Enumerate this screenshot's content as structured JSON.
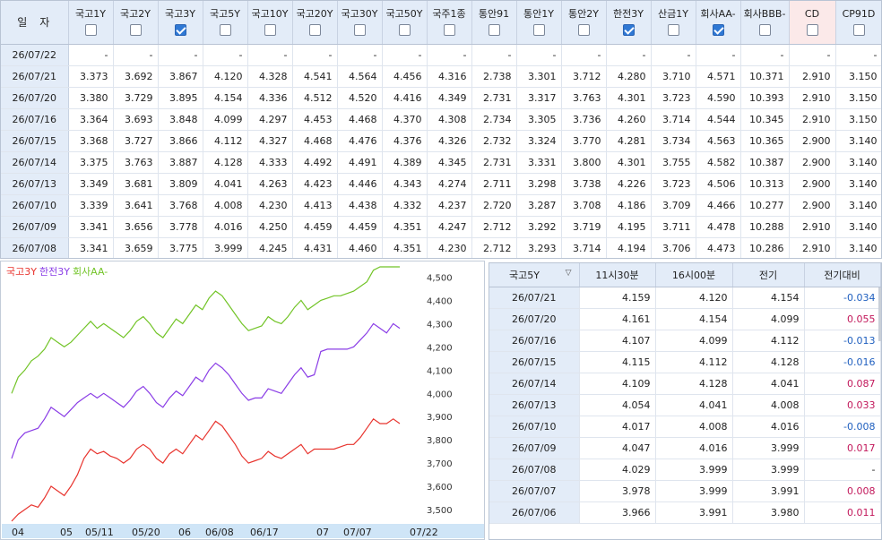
{
  "top_grid": {
    "date_header": "일자",
    "columns": [
      {
        "label": "국고1Y",
        "checked": false
      },
      {
        "label": "국고2Y",
        "checked": false
      },
      {
        "label": "국고3Y",
        "checked": true
      },
      {
        "label": "국고5Y",
        "checked": false
      },
      {
        "label": "국고10Y",
        "checked": false
      },
      {
        "label": "국고20Y",
        "checked": false
      },
      {
        "label": "국고30Y",
        "checked": false
      },
      {
        "label": "국고50Y",
        "checked": false
      },
      {
        "label": "국주1종",
        "checked": false
      },
      {
        "label": "통안91",
        "checked": false
      },
      {
        "label": "통안1Y",
        "checked": false
      },
      {
        "label": "통안2Y",
        "checked": false
      },
      {
        "label": "한전3Y",
        "checked": true
      },
      {
        "label": "산금1Y",
        "checked": false
      },
      {
        "label": "회사AA-",
        "checked": true
      },
      {
        "label": "회사BBB-",
        "checked": false
      },
      {
        "label": "CD",
        "checked": false,
        "pink": true
      },
      {
        "label": "CP91D",
        "checked": false
      }
    ],
    "rows": [
      {
        "date": "26/07/22",
        "values": [
          "-",
          "-",
          "-",
          "-",
          "-",
          "-",
          "-",
          "-",
          "-",
          "-",
          "-",
          "-",
          "-",
          "-",
          "-",
          "-",
          "-",
          "-"
        ]
      },
      {
        "date": "26/07/21",
        "values": [
          "3.373",
          "3.692",
          "3.867",
          "4.120",
          "4.328",
          "4.541",
          "4.564",
          "4.456",
          "4.316",
          "2.738",
          "3.301",
          "3.712",
          "4.280",
          "3.710",
          "4.571",
          "10.371",
          "2.910",
          "3.150"
        ]
      },
      {
        "date": "26/07/20",
        "values": [
          "3.380",
          "3.729",
          "3.895",
          "4.154",
          "4.336",
          "4.512",
          "4.520",
          "4.416",
          "4.349",
          "2.731",
          "3.317",
          "3.763",
          "4.301",
          "3.723",
          "4.590",
          "10.393",
          "2.910",
          "3.150"
        ]
      },
      {
        "date": "26/07/16",
        "values": [
          "3.364",
          "3.693",
          "3.848",
          "4.099",
          "4.297",
          "4.453",
          "4.468",
          "4.370",
          "4.308",
          "2.734",
          "3.305",
          "3.736",
          "4.260",
          "3.714",
          "4.544",
          "10.345",
          "2.910",
          "3.150"
        ]
      },
      {
        "date": "26/07/15",
        "values": [
          "3.368",
          "3.727",
          "3.866",
          "4.112",
          "4.327",
          "4.468",
          "4.476",
          "4.376",
          "4.326",
          "2.732",
          "3.324",
          "3.770",
          "4.281",
          "3.734",
          "4.563",
          "10.365",
          "2.900",
          "3.140"
        ]
      },
      {
        "date": "26/07/14",
        "values": [
          "3.375",
          "3.763",
          "3.887",
          "4.128",
          "4.333",
          "4.492",
          "4.491",
          "4.389",
          "4.345",
          "2.731",
          "3.331",
          "3.800",
          "4.301",
          "3.755",
          "4.582",
          "10.387",
          "2.900",
          "3.140"
        ]
      },
      {
        "date": "26/07/13",
        "values": [
          "3.349",
          "3.681",
          "3.809",
          "4.041",
          "4.263",
          "4.423",
          "4.446",
          "4.343",
          "4.274",
          "2.711",
          "3.298",
          "3.738",
          "4.226",
          "3.723",
          "4.506",
          "10.313",
          "2.900",
          "3.140"
        ]
      },
      {
        "date": "26/07/10",
        "values": [
          "3.339",
          "3.641",
          "3.768",
          "4.008",
          "4.230",
          "4.413",
          "4.438",
          "4.332",
          "4.237",
          "2.720",
          "3.287",
          "3.708",
          "4.186",
          "3.709",
          "4.466",
          "10.277",
          "2.900",
          "3.140"
        ]
      },
      {
        "date": "26/07/09",
        "values": [
          "3.341",
          "3.656",
          "3.778",
          "4.016",
          "4.250",
          "4.459",
          "4.459",
          "4.351",
          "4.247",
          "2.712",
          "3.292",
          "3.719",
          "4.195",
          "3.711",
          "4.478",
          "10.288",
          "2.910",
          "3.140"
        ]
      },
      {
        "date": "26/07/08",
        "values": [
          "3.341",
          "3.659",
          "3.775",
          "3.999",
          "4.245",
          "4.431",
          "4.460",
          "4.351",
          "4.230",
          "2.712",
          "3.293",
          "3.714",
          "4.194",
          "3.706",
          "4.473",
          "10.286",
          "2.910",
          "3.140"
        ]
      }
    ]
  },
  "chart": {
    "legend": [
      {
        "label": "국고3Y",
        "color": "#e8342e"
      },
      {
        "label": "한전3Y",
        "color": "#8a3de6"
      },
      {
        "label": "회사AA-",
        "color": "#72c427"
      }
    ]
  },
  "chart_data": {
    "type": "line",
    "title": "",
    "xlabel": "",
    "ylabel": "",
    "ylim": [
      3.45,
      4.55
    ],
    "y_ticks": [
      "4,500",
      "4,400",
      "4,300",
      "4,200",
      "4,100",
      "4,000",
      "3,900",
      "3,800",
      "3,700",
      "3,600",
      "3,500"
    ],
    "x_ticks": [
      "04",
      "05",
      "05/11",
      "05/20",
      "06",
      "06/08",
      "06/17",
      "07",
      "07/07",
      "07/22"
    ],
    "series": [
      {
        "name": "국고3Y",
        "color": "#e8342e",
        "values": [
          3.45,
          3.48,
          3.5,
          3.52,
          3.51,
          3.55,
          3.6,
          3.58,
          3.56,
          3.6,
          3.65,
          3.72,
          3.76,
          3.74,
          3.75,
          3.73,
          3.72,
          3.7,
          3.72,
          3.76,
          3.78,
          3.76,
          3.72,
          3.7,
          3.74,
          3.76,
          3.74,
          3.78,
          3.82,
          3.8,
          3.84,
          3.88,
          3.86,
          3.82,
          3.78,
          3.73,
          3.7,
          3.71,
          3.72,
          3.75,
          3.73,
          3.72,
          3.74,
          3.76,
          3.78,
          3.74,
          3.76,
          3.76,
          3.76,
          3.76,
          3.77,
          3.78,
          3.78,
          3.81,
          3.85,
          3.89,
          3.87,
          3.87,
          3.89,
          3.87
        ]
      },
      {
        "name": "한전3Y",
        "color": "#8a3de6",
        "values": [
          3.72,
          3.8,
          3.83,
          3.84,
          3.85,
          3.89,
          3.94,
          3.92,
          3.9,
          3.93,
          3.96,
          3.98,
          4.0,
          3.98,
          4.0,
          3.98,
          3.96,
          3.94,
          3.97,
          4.01,
          4.03,
          4.0,
          3.96,
          3.94,
          3.98,
          4.01,
          3.99,
          4.03,
          4.07,
          4.05,
          4.1,
          4.13,
          4.11,
          4.08,
          4.04,
          4.0,
          3.97,
          3.98,
          3.98,
          4.02,
          4.01,
          4.0,
          4.04,
          4.08,
          4.11,
          4.07,
          4.08,
          4.18,
          4.19,
          4.19,
          4.19,
          4.19,
          4.2,
          4.23,
          4.26,
          4.3,
          4.28,
          4.26,
          4.3,
          4.28
        ]
      },
      {
        "name": "회사AA-",
        "color": "#72c427",
        "values": [
          4.0,
          4.07,
          4.1,
          4.14,
          4.16,
          4.19,
          4.24,
          4.22,
          4.2,
          4.22,
          4.25,
          4.28,
          4.31,
          4.28,
          4.3,
          4.28,
          4.26,
          4.24,
          4.27,
          4.31,
          4.33,
          4.3,
          4.26,
          4.24,
          4.28,
          4.32,
          4.3,
          4.34,
          4.38,
          4.36,
          4.41,
          4.44,
          4.42,
          4.38,
          4.34,
          4.3,
          4.27,
          4.28,
          4.29,
          4.33,
          4.31,
          4.3,
          4.33,
          4.37,
          4.4,
          4.36,
          4.38,
          4.4,
          4.41,
          4.42,
          4.42,
          4.43,
          4.44,
          4.46,
          4.48,
          4.53,
          4.56,
          4.57,
          4.58,
          4.59
        ]
      }
    ]
  },
  "bottom_grid": {
    "select_label": "국고5Y",
    "headers": [
      "11시30분",
      "16시00분",
      "전기",
      "전기대비"
    ],
    "rows": [
      {
        "date": "26/07/21",
        "v1": "4.159",
        "v2": "4.120",
        "v3": "4.154",
        "diff": "-0.034",
        "sign": "neg"
      },
      {
        "date": "26/07/20",
        "v1": "4.161",
        "v2": "4.154",
        "v3": "4.099",
        "diff": "0.055",
        "sign": "pos"
      },
      {
        "date": "26/07/16",
        "v1": "4.107",
        "v2": "4.099",
        "v3": "4.112",
        "diff": "-0.013",
        "sign": "neg"
      },
      {
        "date": "26/07/15",
        "v1": "4.115",
        "v2": "4.112",
        "v3": "4.128",
        "diff": "-0.016",
        "sign": "neg"
      },
      {
        "date": "26/07/14",
        "v1": "4.109",
        "v2": "4.128",
        "v3": "4.041",
        "diff": "0.087",
        "sign": "pos"
      },
      {
        "date": "26/07/13",
        "v1": "4.054",
        "v2": "4.041",
        "v3": "4.008",
        "diff": "0.033",
        "sign": "pos"
      },
      {
        "date": "26/07/10",
        "v1": "4.017",
        "v2": "4.008",
        "v3": "4.016",
        "diff": "-0.008",
        "sign": "neg"
      },
      {
        "date": "26/07/09",
        "v1": "4.047",
        "v2": "4.016",
        "v3": "3.999",
        "diff": "0.017",
        "sign": "pos"
      },
      {
        "date": "26/07/08",
        "v1": "4.029",
        "v2": "3.999",
        "v3": "3.999",
        "diff": "-",
        "sign": "zero"
      },
      {
        "date": "26/07/07",
        "v1": "3.978",
        "v2": "3.999",
        "v3": "3.991",
        "diff": "0.008",
        "sign": "pos"
      },
      {
        "date": "26/07/06",
        "v1": "3.966",
        "v2": "3.991",
        "v3": "3.980",
        "diff": "0.011",
        "sign": "pos"
      }
    ]
  }
}
